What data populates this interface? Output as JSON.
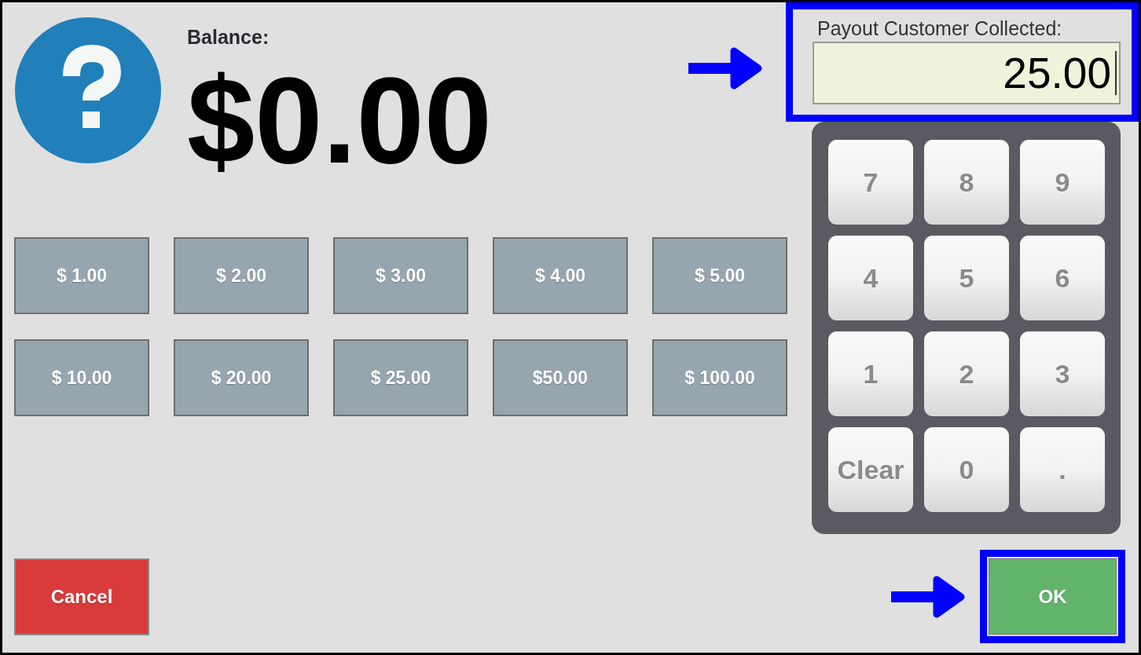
{
  "balance": {
    "label": "Balance:",
    "amount": "$0.00"
  },
  "payout_field": {
    "label": "Payout Customer Collected:",
    "value": "25.00",
    "focused": true,
    "highlighted": true
  },
  "quick_amounts": [
    "$ 1.00",
    "$ 2.00",
    "$ 3.00",
    "$ 4.00",
    "$ 5.00",
    "$ 10.00",
    "$ 20.00",
    "$ 25.00",
    "$50.00",
    "$ 100.00"
  ],
  "keypad": [
    "7",
    "8",
    "9",
    "4",
    "5",
    "6",
    "1",
    "2",
    "3",
    "Clear",
    "0",
    "."
  ],
  "cancel_button": {
    "label": "Cancel"
  },
  "ok_button": {
    "label": "OK",
    "highlighted": true
  }
}
